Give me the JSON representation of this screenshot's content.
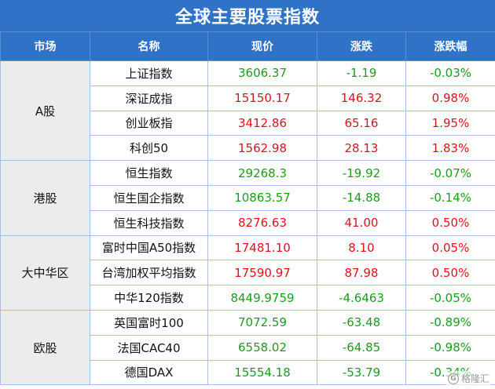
{
  "title": "全球主要股票指数",
  "headers": [
    "市场",
    "名称",
    "现价",
    "涨跌",
    "涨跌幅"
  ],
  "colors": {
    "header_bg": "#2f72c8",
    "up": "#d9141c",
    "down": "#1d9a1d",
    "market_bg": "#ececec"
  },
  "groups": [
    {
      "market": "A股",
      "rows": [
        {
          "name": "上证指数",
          "price": "3606.37",
          "change": "-1.19",
          "pct": "-0.03%",
          "dir": "down"
        },
        {
          "name": "深证成指",
          "price": "15150.17",
          "change": "146.32",
          "pct": "0.98%",
          "dir": "up"
        },
        {
          "name": "创业板指",
          "price": "3412.86",
          "change": "65.16",
          "pct": "1.95%",
          "dir": "up"
        },
        {
          "name": "科创50",
          "price": "1562.98",
          "change": "28.13",
          "pct": "1.83%",
          "dir": "up"
        }
      ]
    },
    {
      "market": "港股",
      "rows": [
        {
          "name": "恒生指数",
          "price": "29268.3",
          "change": "-19.92",
          "pct": "-0.07%",
          "dir": "down"
        },
        {
          "name": "恒生国企指数",
          "price": "10863.57",
          "change": "-14.88",
          "pct": "-0.14%",
          "dir": "down"
        },
        {
          "name": "恒生科技指数",
          "price": "8276.63",
          "change": "41.00",
          "pct": "0.50%",
          "dir": "up"
        }
      ]
    },
    {
      "market": "大中华区",
      "rows": [
        {
          "name": "富时中国A50指数",
          "price": "17481.10",
          "change": "8.10",
          "pct": "0.05%",
          "dir": "up"
        },
        {
          "name": "台湾加权平均指数",
          "price": "17590.97",
          "change": "87.98",
          "pct": "0.50%",
          "dir": "up"
        },
        {
          "name": "中华120指数",
          "price": "8449.9759",
          "change": "-4.6463",
          "pct": "-0.05%",
          "dir": "down"
        }
      ]
    },
    {
      "market": "欧股",
      "rows": [
        {
          "name": "英国富时100",
          "price": "7072.59",
          "change": "-63.48",
          "pct": "-0.89%",
          "dir": "down"
        },
        {
          "name": "法国CAC40",
          "price": "6558.02",
          "change": "-64.85",
          "pct": "-0.98%",
          "dir": "down"
        },
        {
          "name": "德国DAX",
          "price": "15554.18",
          "change": "-53.79",
          "pct": "-0.34%",
          "dir": "down"
        }
      ]
    }
  ],
  "watermark": {
    "icon": "gelonghui-logo-icon",
    "text": "格隆汇"
  }
}
